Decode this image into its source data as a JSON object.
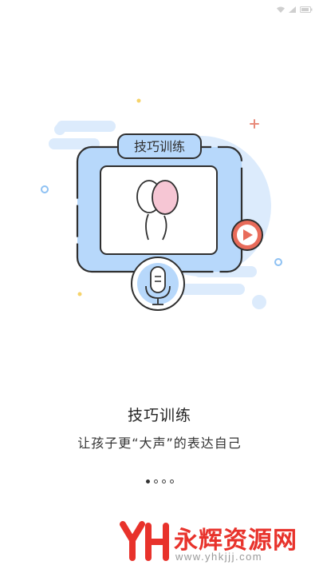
{
  "status_bar": {
    "icons": [
      "wifi-icon",
      "signal-icon",
      "battery-icon"
    ]
  },
  "illustration": {
    "badge_label": "技巧训练",
    "icons": [
      "balloons-icon",
      "microphone-icon",
      "play-icon"
    ]
  },
  "onboarding": {
    "title": "技巧训练",
    "subtitle": "让孩子更“大声”的表达自己",
    "page_count": 4,
    "active_page": 1
  },
  "watermark": {
    "brand": "永辉资源网",
    "url": "www.yhkjjj.com"
  },
  "colors": {
    "accent_blue": "#b7d8fb",
    "outline": "#2f2f2f",
    "balloon_pink": "#f6c6d4",
    "play_red": "#e86b5a",
    "watermark_red": "#e8322b"
  }
}
